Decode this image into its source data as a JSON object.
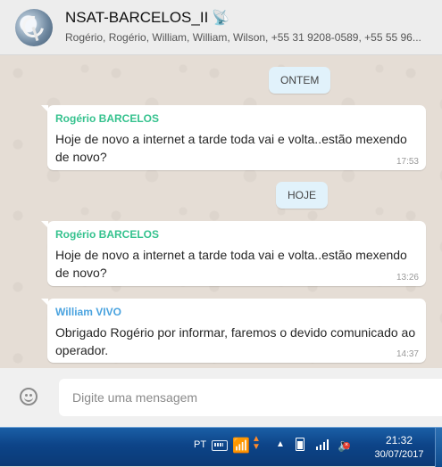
{
  "header": {
    "title": "NSAT-BARCELOS_II",
    "title_icon": "satellite-antenna-icon",
    "subtitle": "Rogério, Rogério, William, William, Wilson, +55 31 9208-0589, +55 55 96..."
  },
  "colors": {
    "accent_sender_green": "#35c28e",
    "accent_sender_blue": "#4aa3df",
    "chat_background": "#e5ddd5",
    "date_chip": "#e1f2fb"
  },
  "messages": [
    {
      "type": "date",
      "label": "ONTEM"
    },
    {
      "type": "message",
      "sender": "Rogério BARCELOS",
      "sender_color": "#35c28e",
      "text": "Hoje de novo a internet a tarde toda vai e volta..estão mexendo de novo?",
      "time": "17:53"
    },
    {
      "type": "date",
      "label": "HOJE"
    },
    {
      "type": "message",
      "sender": "Rogério BARCELOS",
      "sender_color": "#35c28e",
      "text": "Hoje de novo a internet a tarde toda vai e volta..estão mexendo de novo?",
      "time": "13:26"
    },
    {
      "type": "message",
      "sender": "William VIVO",
      "sender_color": "#4aa3df",
      "text": "Obrigado Rogério por informar, faremos o devido comunicado ao operador.",
      "time": "14:37"
    }
  ],
  "composer": {
    "emoji_icon": "smiley-icon",
    "placeholder": "Digite uma mensagem"
  },
  "taskbar": {
    "language": "PT",
    "time": "21:32",
    "date": "30/07/2017"
  }
}
